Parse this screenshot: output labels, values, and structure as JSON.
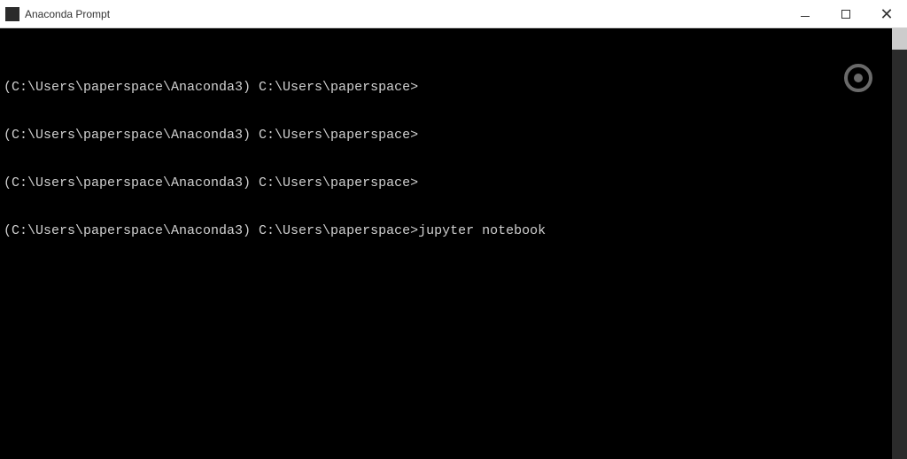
{
  "window": {
    "title": "Anaconda Prompt"
  },
  "terminal": {
    "lines": [
      {
        "prompt": "(C:\\Users\\paperspace\\Anaconda3) C:\\Users\\paperspace>",
        "command": ""
      },
      {
        "prompt": "(C:\\Users\\paperspace\\Anaconda3) C:\\Users\\paperspace>",
        "command": ""
      },
      {
        "prompt": "(C:\\Users\\paperspace\\Anaconda3) C:\\Users\\paperspace>",
        "command": ""
      },
      {
        "prompt": "(C:\\Users\\paperspace\\Anaconda3) C:\\Users\\paperspace>",
        "command": "jupyter notebook"
      }
    ]
  },
  "controls": {
    "minimize": "–",
    "maximize": "□",
    "close": "✕"
  }
}
